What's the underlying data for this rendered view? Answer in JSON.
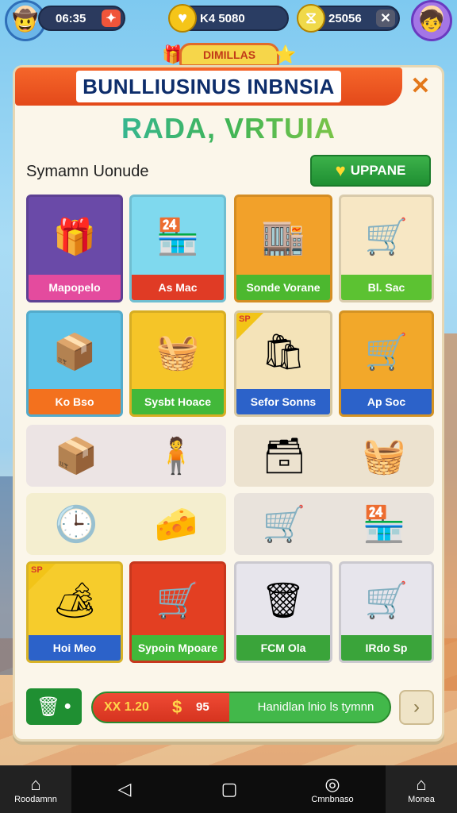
{
  "hud": {
    "player_value": "06:35",
    "coins": "K4 5080",
    "gems": "25056",
    "plus_icon": "plus-icon"
  },
  "mini_banner": "DIMILLAS",
  "panel": {
    "title": "BUNLLIUSINUS INBNSIA",
    "close": "✕",
    "subtitle": "RADA, VRTUIA",
    "section_label": "Symamn Uonude",
    "upgrade_label": "UPPANE"
  },
  "cards": [
    {
      "label": "Mapopelo",
      "icon": "gift-boxes-icon",
      "color": "#e44b9e",
      "bg": "#6a4aa8"
    },
    {
      "label": "As Mac",
      "icon": "shop-stall-icon",
      "color": "#e03b25",
      "bg": "#7fd9ee"
    },
    {
      "label": "Sonde Vorane",
      "icon": "shop-building-icon",
      "color": "#4cb82f",
      "bg": "#f2a12a"
    },
    {
      "label": "Bl. Sac",
      "icon": "shopping-cart-icon",
      "color": "#5cc232",
      "bg": "#f7e7c4"
    },
    {
      "label": "Ko Bso",
      "icon": "fruit-box-icon",
      "color": "#f3711e",
      "bg": "#5fc3e8"
    },
    {
      "label": "Sysbt Hoace",
      "icon": "basket-icon",
      "color": "#42b83a",
      "bg": "#f5c528"
    },
    {
      "label": "Sefor Sonns",
      "icon": "cart-goods-icon",
      "color": "#2c62c9",
      "bg": "#f4e3b8",
      "ribbon": "SP"
    },
    {
      "label": "Ap Soc",
      "icon": "trolley-icon",
      "color": "#2c62c9",
      "bg": "#f2a82a"
    },
    {
      "label": "Hoi Meo",
      "icon": "market-stall-icon",
      "color": "#2c62c9",
      "bg": "#f6cc2c",
      "ribbon": "SP"
    },
    {
      "label": "Sypoin Mpoare",
      "icon": "cart-icon",
      "color": "#42b83a",
      "bg": "#e33f22"
    },
    {
      "label": "FCM Ola",
      "icon": "bin-cart-icon",
      "color": "#3aa43a",
      "bg": "#e7e5ec"
    },
    {
      "label": "IRdo Sp",
      "icon": "red-cart-icon",
      "color": "#3aa43a",
      "bg": "#e7e5ec"
    }
  ],
  "bottom": {
    "value": "XX 1.20",
    "dollar": "$",
    "amount": "95",
    "message": "Hanidlan lnio ls tymnn",
    "next": "›",
    "progress": 0.46
  },
  "nav": {
    "home": "Roodamnn",
    "compass": "Cmnbnaso",
    "menu": "Monea"
  }
}
